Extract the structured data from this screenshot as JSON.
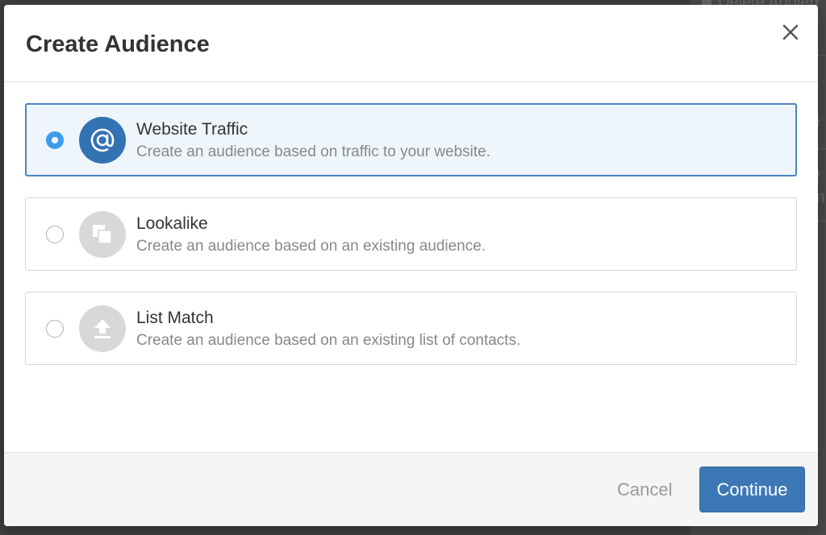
{
  "background": {
    "fragments": [
      "Delete Audien",
      "e",
      "o",
      "m"
    ]
  },
  "modal": {
    "title": "Create Audience",
    "close_icon": "close-icon"
  },
  "options": [
    {
      "title": "Website Traffic",
      "description": "Create an audience based on traffic to your website.",
      "icon": "at-sign-icon",
      "selected": true
    },
    {
      "title": "Lookalike",
      "description": "Create an audience based on an existing audience.",
      "icon": "overlapping-squares-icon",
      "selected": false
    },
    {
      "title": "List Match",
      "description": "Create an audience based on an existing list of contacts.",
      "icon": "upload-icon",
      "selected": false
    }
  ],
  "footer": {
    "cancel_label": "Cancel",
    "continue_label": "Continue"
  },
  "colors": {
    "primary": "#3c78b5",
    "selected_radio": "#3e9cf0",
    "selected_bg": "#eef6fb",
    "icon_inactive": "#d8d8d8"
  }
}
